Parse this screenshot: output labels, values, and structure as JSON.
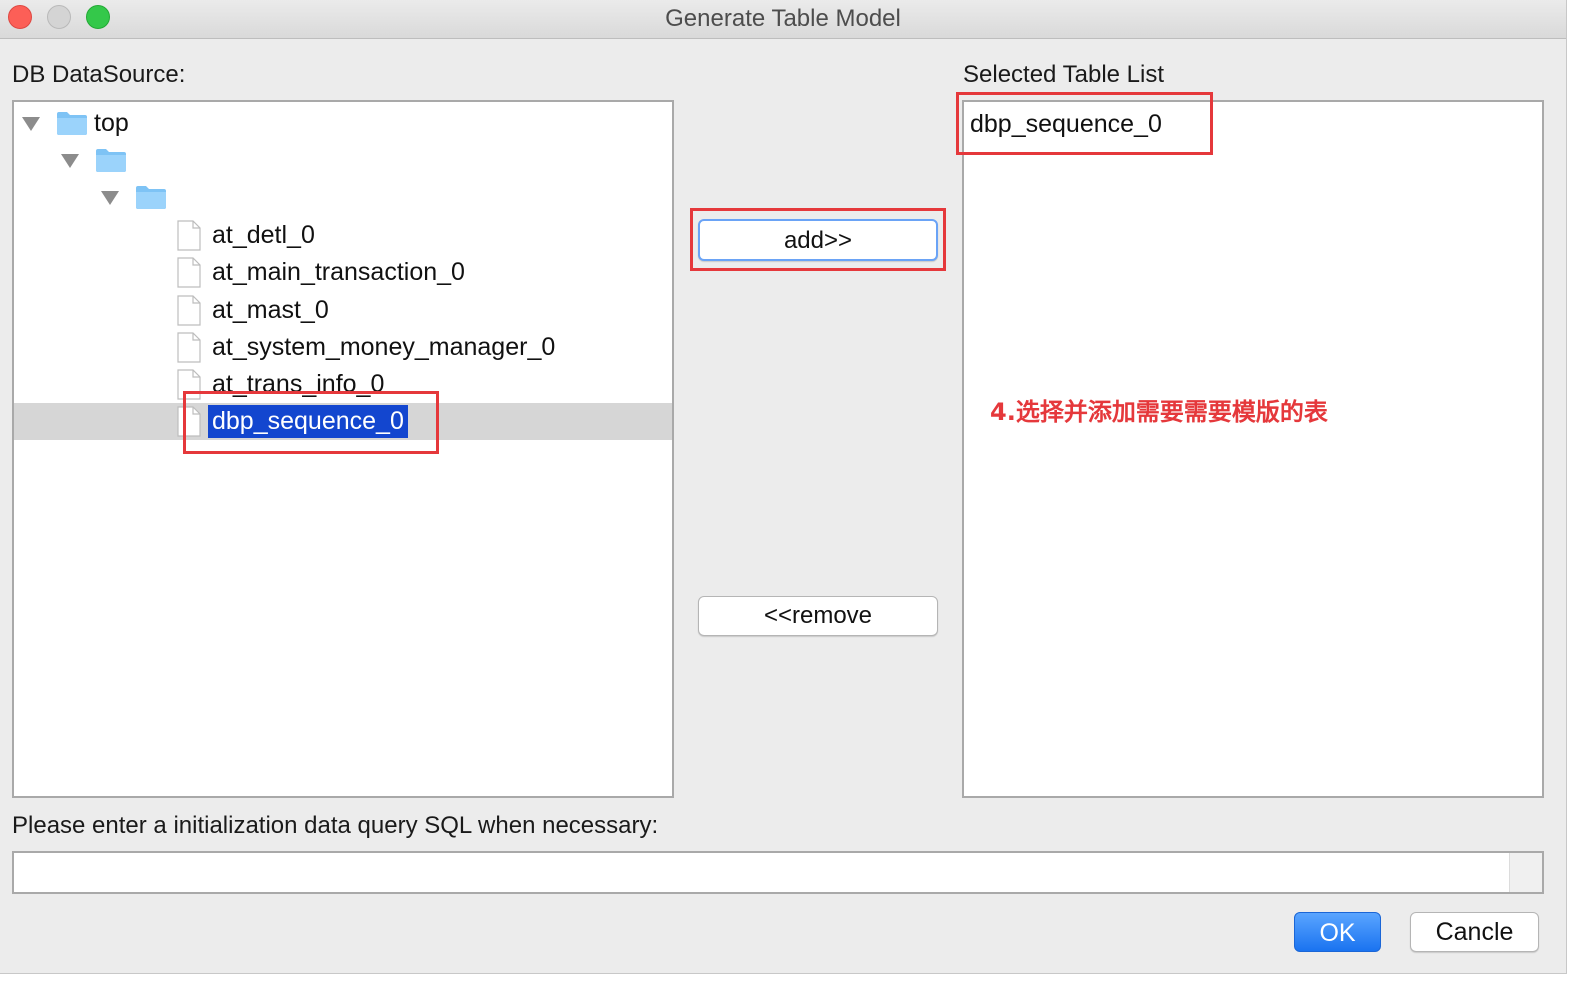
{
  "window": {
    "title": "Generate Table Model"
  },
  "left_panel": {
    "label": "DB DataSource:",
    "tree": {
      "root_label": "top",
      "folder_level1_label": "",
      "folder_level2_label": "",
      "tables": [
        "at_detl_0",
        "at_main_transaction_0",
        "at_mast_0",
        "at_system_money_manager_0",
        "at_trans_info_0",
        "dbp_sequence_0"
      ],
      "selected_table": "dbp_sequence_0"
    }
  },
  "buttons": {
    "add": "add>>",
    "remove": "<<remove",
    "ok": "OK",
    "cancel": "Cancle"
  },
  "right_panel": {
    "label": "Selected Table List",
    "items": [
      "dbp_sequence_0"
    ]
  },
  "annotation": {
    "text": "4.选择并添加需要需要模版的表",
    "color": "#e5383b"
  },
  "sql": {
    "label": "Please enter a initialization data query SQL when necessary:",
    "value": ""
  },
  "colors": {
    "selection": "#1346cf",
    "ok_button": "#1a73f0",
    "annotation_box": "#e5383b"
  },
  "icons": {
    "folder": "folder-icon",
    "file": "file-icon",
    "disclosure": "disclosure-triangle-icon"
  }
}
